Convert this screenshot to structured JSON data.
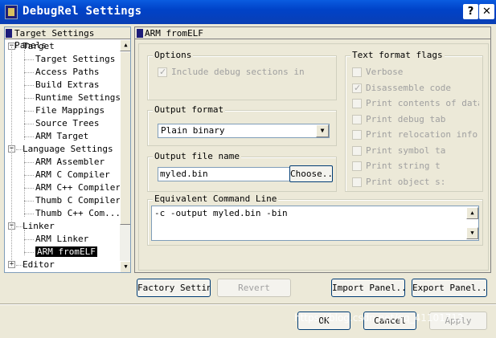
{
  "window": {
    "title": "DebugRel Settings",
    "help_glyph": "?",
    "close_glyph": "✕"
  },
  "tree": {
    "header": "Target Settings Panels",
    "items": [
      {
        "label": "Target",
        "expander": "−"
      },
      {
        "label": "Target Settings"
      },
      {
        "label": "Access Paths"
      },
      {
        "label": "Build Extras"
      },
      {
        "label": "Runtime Settings"
      },
      {
        "label": "File Mappings"
      },
      {
        "label": "Source Trees"
      },
      {
        "label": "ARM Target"
      },
      {
        "label": "Language Settings",
        "expander": "−"
      },
      {
        "label": "ARM Assembler"
      },
      {
        "label": "ARM C Compiler"
      },
      {
        "label": "ARM C++ Compiler"
      },
      {
        "label": "Thumb C Compiler"
      },
      {
        "label": "Thumb C++ Com..."
      },
      {
        "label": "Linker",
        "expander": "−"
      },
      {
        "label": "ARM Linker"
      },
      {
        "label": "ARM fromELF",
        "selected": true
      },
      {
        "label": "Editor",
        "expander": "+"
      }
    ]
  },
  "panel": {
    "title": "ARM fromELF",
    "options": {
      "label": "Options",
      "include_debug": {
        "label": "Include debug sections in o",
        "checked": true
      }
    },
    "output_format": {
      "label": "Output format",
      "value": "Plain binary"
    },
    "output_file": {
      "label": "Output file name",
      "value": "myled.bin",
      "choose_label": "Choose..."
    },
    "text_flags": {
      "label": "Text format flags",
      "items": [
        {
          "label": "Verbose",
          "checked": false
        },
        {
          "label": "Disassemble code",
          "checked": true
        },
        {
          "label": "Print contents of data s",
          "checked": false
        },
        {
          "label": "Print debug tab",
          "checked": false
        },
        {
          "label": "Print relocation infor",
          "checked": false
        },
        {
          "label": "Print symbol ta",
          "checked": false
        },
        {
          "label": "Print string t",
          "checked": false
        },
        {
          "label": "Print object s:",
          "checked": false
        }
      ]
    },
    "command_line": {
      "label": "Equivalent Command Line",
      "value": "-c -output myled.bin -bin"
    }
  },
  "buttons": {
    "factory": "Factory Settings",
    "revert": "Revert",
    "import": "Import Panel...",
    "export": "Export Panel...",
    "ok": "OK",
    "cancel": "Cancel",
    "apply": "Apply"
  },
  "watermark": "https://blog.csdn.net/qq_41101712"
}
